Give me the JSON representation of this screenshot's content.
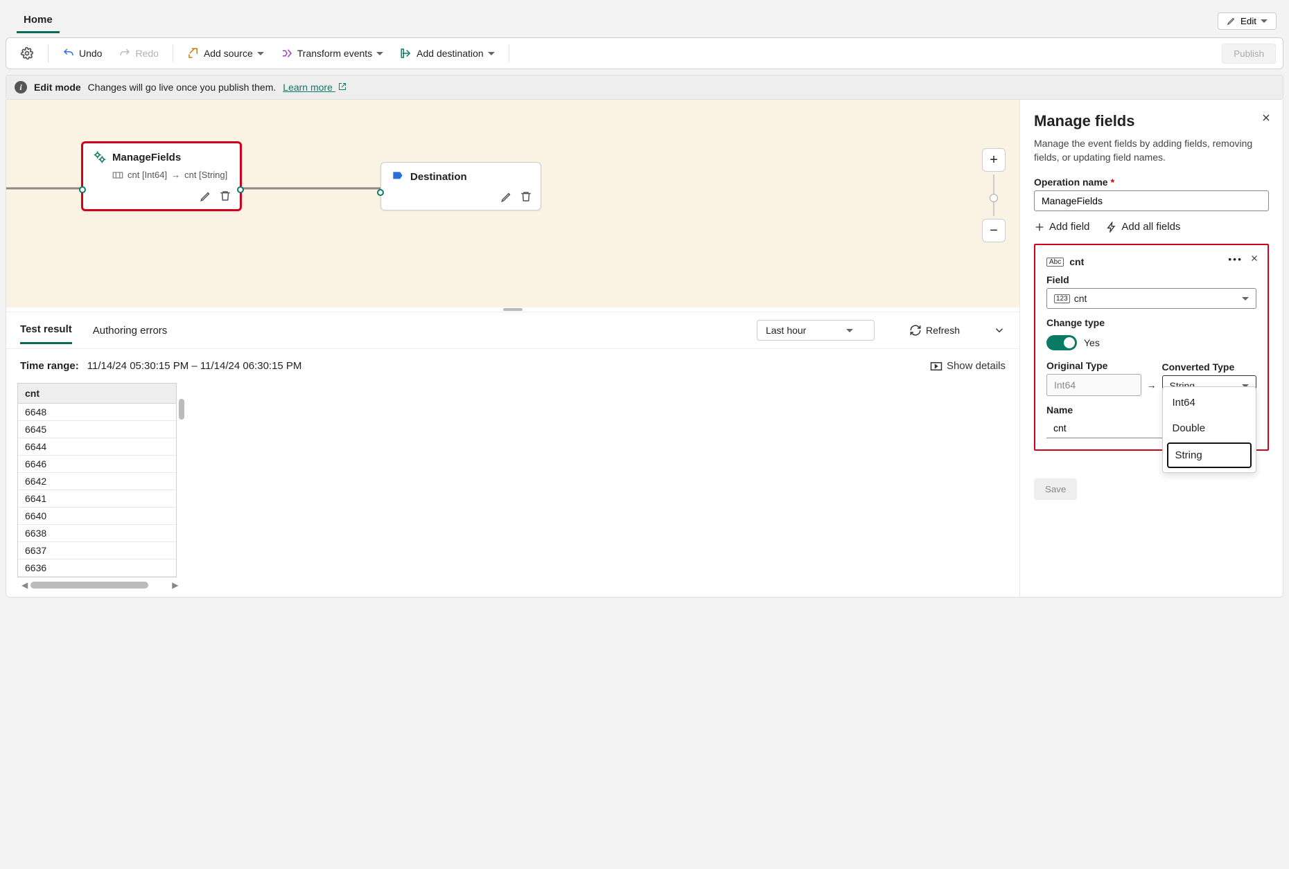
{
  "top": {
    "tab_home": "Home",
    "edit": "Edit"
  },
  "toolbar": {
    "undo": "Undo",
    "redo": "Redo",
    "add_source": "Add source",
    "transform": "Transform events",
    "add_dest": "Add destination",
    "publish": "Publish"
  },
  "infobar": {
    "mode": "Edit mode",
    "msg": "Changes will go live once you publish them.",
    "learn": "Learn more"
  },
  "canvas": {
    "manage_fields": {
      "title": "ManageFields",
      "map_from": "cnt [Int64]",
      "map_to": "cnt [String]"
    },
    "destination": {
      "title": "Destination"
    }
  },
  "lower_tabs": {
    "test_result": "Test result",
    "authoring_errors": "Authoring errors",
    "last_hour": "Last hour",
    "refresh": "Refresh"
  },
  "time_range": {
    "label": "Time range:",
    "value": "11/14/24 05:30:15 PM  –  11/14/24 06:30:15 PM",
    "show_details": "Show details"
  },
  "table": {
    "header": "cnt",
    "rows": [
      "6648",
      "6645",
      "6644",
      "6646",
      "6642",
      "6641",
      "6640",
      "6638",
      "6637",
      "6636"
    ]
  },
  "panel": {
    "title": "Manage fields",
    "desc": "Manage the event fields by adding fields, removing fields, or updating field names.",
    "op_name_label": "Operation name",
    "op_name_value": "ManageFields",
    "add_field": "Add field",
    "add_all": "Add all fields",
    "field": {
      "name_header": "cnt",
      "field_label": "Field",
      "field_value": "cnt",
      "change_type_label": "Change type",
      "yes": "Yes",
      "orig_label": "Original Type",
      "orig_value": "Int64",
      "conv_label": "Converted Type",
      "conv_value": "String",
      "name_label": "Name",
      "name_value": "cnt",
      "options": [
        "Int64",
        "Double",
        "String"
      ]
    },
    "save": "Save"
  }
}
